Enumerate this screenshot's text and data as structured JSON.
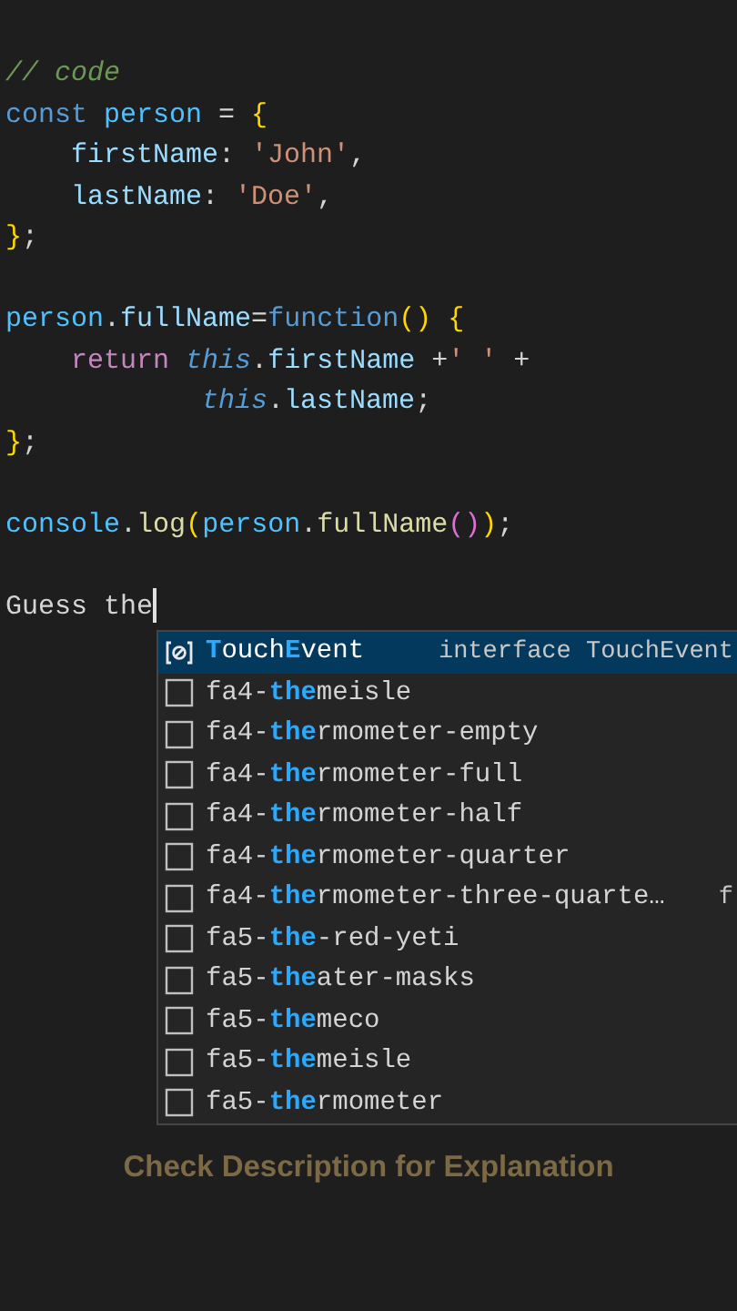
{
  "editor": {
    "blocks": [
      [
        {
          "tokens": [
            {
              "t": "// code",
              "kind": "comment"
            }
          ]
        },
        {
          "tokens": [
            {
              "t": "const ",
              "kind": "keyword"
            },
            {
              "t": "person",
              "kind": "variable"
            },
            {
              "t": " = ",
              "kind": "plain"
            },
            {
              "t": "{",
              "kind": "brace"
            }
          ]
        },
        {
          "tokens": [
            {
              "t": "    firstName",
              "kind": "property"
            },
            {
              "t": ": ",
              "kind": "plain"
            },
            {
              "t": "'John'",
              "kind": "string"
            },
            {
              "t": ",",
              "kind": "plain"
            }
          ]
        },
        {
          "tokens": [
            {
              "t": "    lastName",
              "kind": "property"
            },
            {
              "t": ": ",
              "kind": "plain"
            },
            {
              "t": "'Doe'",
              "kind": "string"
            },
            {
              "t": ",",
              "kind": "plain"
            }
          ]
        },
        {
          "tokens": [
            {
              "t": "}",
              "kind": "brace"
            },
            {
              "t": ";",
              "kind": "plain"
            }
          ]
        }
      ],
      [
        {
          "tokens": [
            {
              "t": "person",
              "kind": "variable"
            },
            {
              "t": ".",
              "kind": "plain"
            },
            {
              "t": "fullName",
              "kind": "property"
            },
            {
              "t": "=",
              "kind": "plain"
            },
            {
              "t": "function",
              "kind": "keyword"
            },
            {
              "t": "() {",
              "kind": "brace"
            }
          ]
        },
        {
          "tokens": [
            {
              "t": "    return ",
              "kind": "control"
            },
            {
              "t": "this",
              "kind": "this"
            },
            {
              "t": ".",
              "kind": "plain"
            },
            {
              "t": "firstName",
              "kind": "property"
            },
            {
              "t": " +",
              "kind": "plain"
            },
            {
              "t": "' '",
              "kind": "string"
            },
            {
              "t": " +",
              "kind": "plain"
            }
          ]
        },
        {
          "tokens": [
            {
              "t": "            this",
              "kind": "this"
            },
            {
              "t": ".",
              "kind": "plain"
            },
            {
              "t": "lastName",
              "kind": "property"
            },
            {
              "t": ";",
              "kind": "plain"
            }
          ]
        },
        {
          "tokens": [
            {
              "t": "}",
              "kind": "brace"
            },
            {
              "t": ";",
              "kind": "plain"
            }
          ]
        }
      ],
      [
        {
          "tokens": [
            {
              "t": "console",
              "kind": "variable"
            },
            {
              "t": ".",
              "kind": "plain"
            },
            {
              "t": "log",
              "kind": "function"
            },
            {
              "t": "(",
              "kind": "brace"
            },
            {
              "t": "person",
              "kind": "variable"
            },
            {
              "t": ".",
              "kind": "plain"
            },
            {
              "t": "fullName",
              "kind": "function"
            },
            {
              "t": "()",
              "kind": "paren2"
            },
            {
              "t": ")",
              "kind": "brace"
            },
            {
              "t": ";",
              "kind": "plain"
            }
          ]
        }
      ],
      [
        {
          "tokens": [
            {
              "t": "Guess the",
              "kind": "plain"
            }
          ],
          "cursor": true
        }
      ]
    ]
  },
  "suggestions": [
    {
      "kind": "interface",
      "selected": true,
      "parts": [
        {
          "t": "T",
          "match": true
        },
        {
          "t": "ouch",
          "match": false
        },
        {
          "t": "E",
          "match": true
        },
        {
          "t": "vent",
          "match": false
        }
      ],
      "detail": "interface TouchEvent"
    },
    {
      "kind": "text",
      "selected": false,
      "parts": [
        {
          "t": "fa4-",
          "match": false
        },
        {
          "t": "the",
          "match": true
        },
        {
          "t": "meisle",
          "match": false
        }
      ]
    },
    {
      "kind": "text",
      "selected": false,
      "parts": [
        {
          "t": "fa4-",
          "match": false
        },
        {
          "t": "the",
          "match": true
        },
        {
          "t": "rmometer-empty",
          "match": false
        }
      ]
    },
    {
      "kind": "text",
      "selected": false,
      "parts": [
        {
          "t": "fa4-",
          "match": false
        },
        {
          "t": "the",
          "match": true
        },
        {
          "t": "rmometer-full",
          "match": false
        }
      ]
    },
    {
      "kind": "text",
      "selected": false,
      "parts": [
        {
          "t": "fa4-",
          "match": false
        },
        {
          "t": "the",
          "match": true
        },
        {
          "t": "rmometer-half",
          "match": false
        }
      ]
    },
    {
      "kind": "text",
      "selected": false,
      "parts": [
        {
          "t": "fa4-",
          "match": false
        },
        {
          "t": "the",
          "match": true
        },
        {
          "t": "rmometer-quarter",
          "match": false
        }
      ]
    },
    {
      "kind": "text",
      "selected": false,
      "parts": [
        {
          "t": "fa4-",
          "match": false
        },
        {
          "t": "the",
          "match": true
        },
        {
          "t": "rmometer-three-quarte…",
          "match": false
        }
      ],
      "detail": "f"
    },
    {
      "kind": "text",
      "selected": false,
      "parts": [
        {
          "t": "fa5-",
          "match": false
        },
        {
          "t": "the",
          "match": true
        },
        {
          "t": "-red-yeti",
          "match": false
        }
      ]
    },
    {
      "kind": "text",
      "selected": false,
      "parts": [
        {
          "t": "fa5-",
          "match": false
        },
        {
          "t": "the",
          "match": true
        },
        {
          "t": "ater-masks",
          "match": false
        }
      ]
    },
    {
      "kind": "text",
      "selected": false,
      "parts": [
        {
          "t": "fa5-",
          "match": false
        },
        {
          "t": "the",
          "match": true
        },
        {
          "t": "meco",
          "match": false
        }
      ]
    },
    {
      "kind": "text",
      "selected": false,
      "parts": [
        {
          "t": "fa5-",
          "match": false
        },
        {
          "t": "the",
          "match": true
        },
        {
          "t": "meisle",
          "match": false
        }
      ]
    },
    {
      "kind": "text",
      "selected": false,
      "parts": [
        {
          "t": "fa5-",
          "match": false
        },
        {
          "t": "the",
          "match": true
        },
        {
          "t": "rmometer",
          "match": false
        }
      ]
    }
  ],
  "caption": "Check Description for Explanation"
}
